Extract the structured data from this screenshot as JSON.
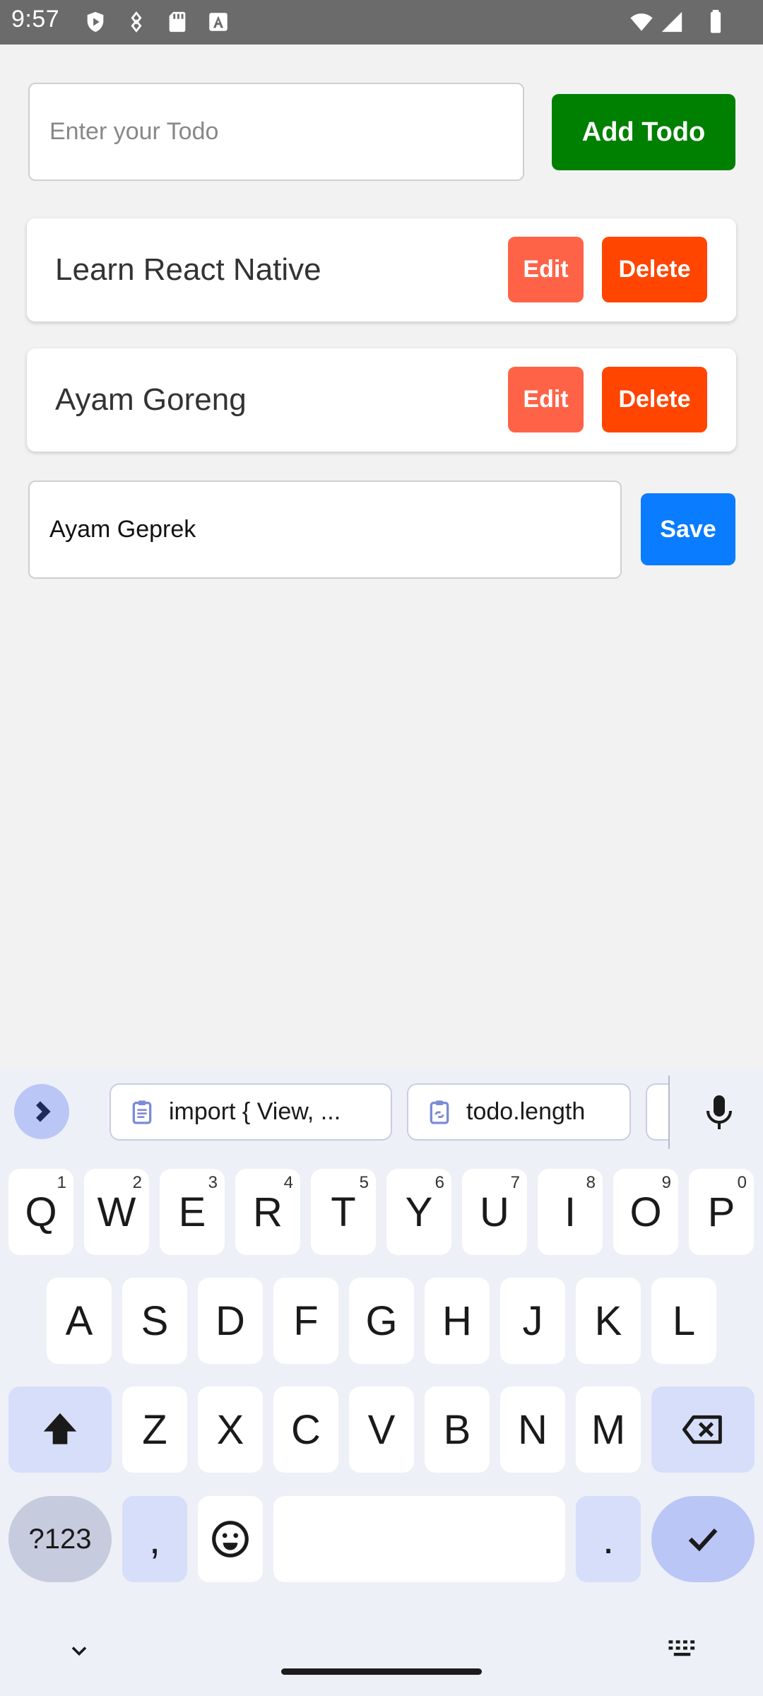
{
  "status_bar": {
    "time": "9:57"
  },
  "todo_input": {
    "placeholder": "Enter your Todo"
  },
  "add_button": {
    "label": "Add Todo"
  },
  "todos": [
    {
      "title": "Learn React Native",
      "edit_label": "Edit",
      "delete_label": "Delete"
    },
    {
      "title": "Ayam Goreng",
      "edit_label": "Edit",
      "delete_label": "Delete"
    }
  ],
  "edit_input": {
    "value": "Ayam Geprek"
  },
  "save_button": {
    "label": "Save"
  },
  "colors": {
    "add_button": "#008000",
    "edit_button": "#ff6347",
    "delete_button": "#ff4500",
    "save_button": "#0a7cff"
  },
  "keyboard": {
    "suggestions": [
      {
        "icon": "clipboard-icon",
        "text": "import { View, ..."
      },
      {
        "icon": "clipboard-link-icon",
        "text": "todo.length"
      }
    ],
    "row1": [
      {
        "key": "Q",
        "hint": "1"
      },
      {
        "key": "W",
        "hint": "2"
      },
      {
        "key": "E",
        "hint": "3"
      },
      {
        "key": "R",
        "hint": "4"
      },
      {
        "key": "T",
        "hint": "5"
      },
      {
        "key": "Y",
        "hint": "6"
      },
      {
        "key": "U",
        "hint": "7"
      },
      {
        "key": "I",
        "hint": "8"
      },
      {
        "key": "O",
        "hint": "9"
      },
      {
        "key": "P",
        "hint": "0"
      }
    ],
    "row2": [
      "A",
      "S",
      "D",
      "F",
      "G",
      "H",
      "J",
      "K",
      "L"
    ],
    "row3": [
      "Z",
      "X",
      "C",
      "V",
      "B",
      "N",
      "M"
    ],
    "symbols_label": "?123",
    "comma": ",",
    "period": "."
  }
}
